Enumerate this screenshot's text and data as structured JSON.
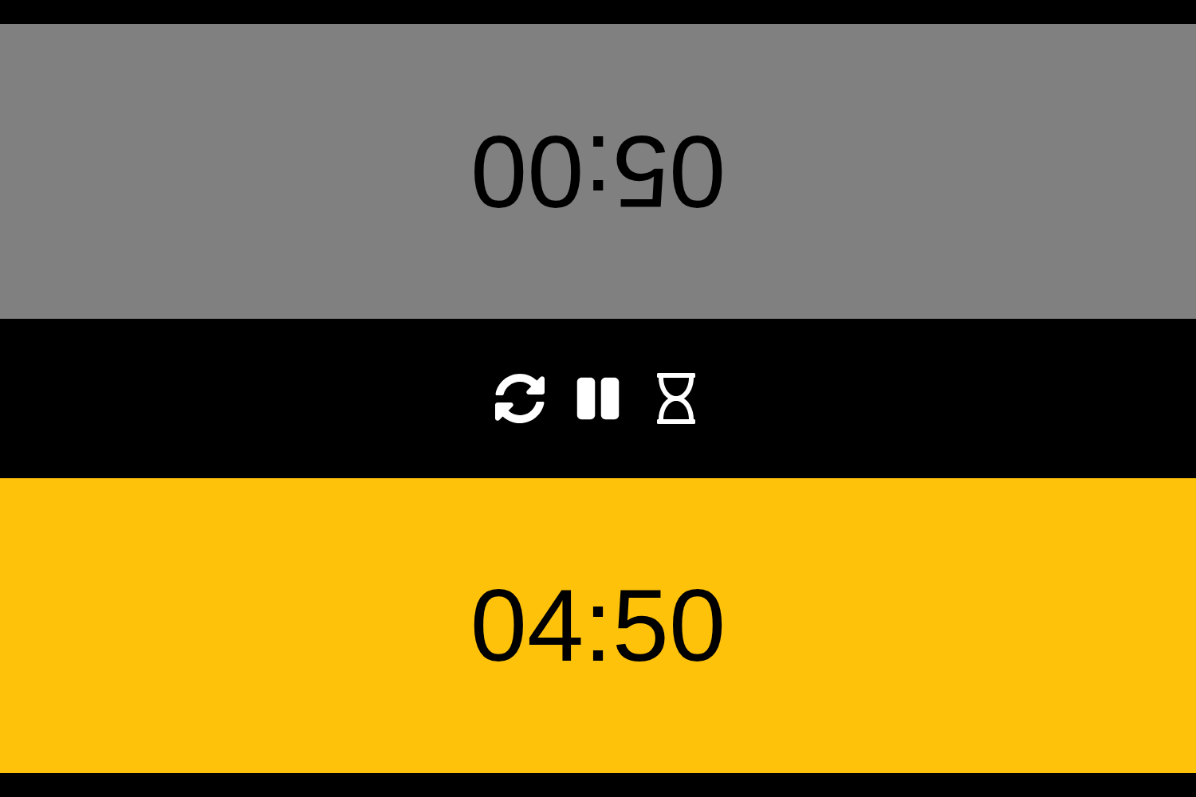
{
  "players": [
    {
      "time": "05:00",
      "active": false,
      "flipped": true
    },
    {
      "time": "04:50",
      "active": true,
      "flipped": false
    }
  ],
  "controls": [
    {
      "kind": "reset"
    },
    {
      "kind": "pause"
    },
    {
      "kind": "timer"
    }
  ]
}
